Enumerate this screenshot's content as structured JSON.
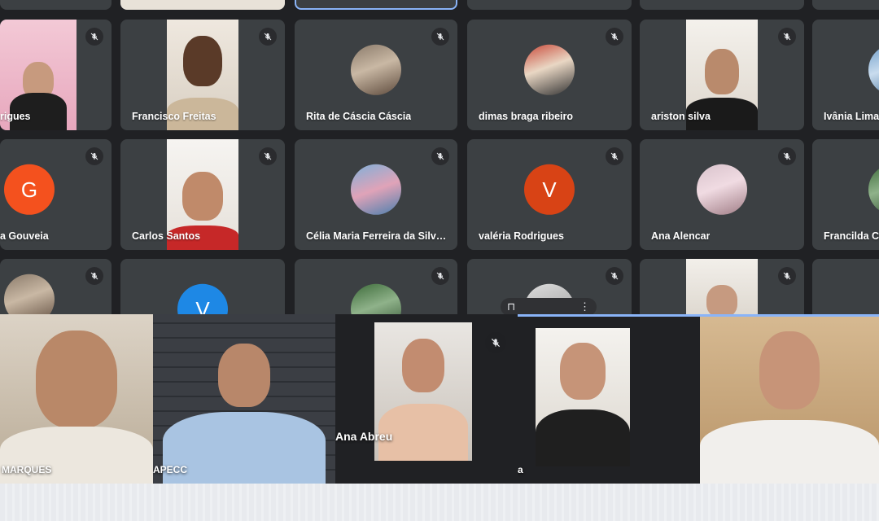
{
  "meeting": {
    "grid_tiles": [
      {
        "id": "t1",
        "name": "rigues",
        "avatar": "camera",
        "muted": true
      },
      {
        "id": "t2",
        "name": "Francisco Freitas",
        "avatar": "camera",
        "muted": true
      },
      {
        "id": "t3",
        "name": "Rita de Cáscia Cáscia",
        "avatar": "photo",
        "muted": true
      },
      {
        "id": "t4",
        "name": "dimas braga ribeiro",
        "avatar": "photo",
        "muted": true
      },
      {
        "id": "t5",
        "name": "ariston silva",
        "avatar": "camera",
        "muted": true
      },
      {
        "id": "t6",
        "name": "Ivânia Lima",
        "avatar": "photo",
        "muted": true
      },
      {
        "id": "t7",
        "name": "a Gouveia",
        "avatar": "letter",
        "letter": "G",
        "color": "#f4511e",
        "muted": true
      },
      {
        "id": "t8",
        "name": "Carlos Santos",
        "avatar": "camera",
        "muted": true
      },
      {
        "id": "t9",
        "name": "Célia Maria Ferreira da Silv…",
        "avatar": "photo",
        "muted": true
      },
      {
        "id": "t10",
        "name": "valéria Rodrigues",
        "avatar": "letter",
        "letter": "V",
        "color": "#d84315",
        "muted": true
      },
      {
        "id": "t11",
        "name": "Ana Alencar",
        "avatar": "photo",
        "muted": true
      },
      {
        "id": "t12",
        "name": "Francilda C",
        "avatar": "photo",
        "muted": true
      },
      {
        "id": "t13",
        "name": "",
        "avatar": "photo",
        "muted": true
      },
      {
        "id": "t14",
        "name": "",
        "avatar": "letter",
        "letter": "V",
        "color": "#1e88e5",
        "muted": true
      },
      {
        "id": "t15",
        "name": "",
        "avatar": "photo",
        "muted": true
      },
      {
        "id": "t16",
        "name": "",
        "avatar": "photo",
        "muted": true
      },
      {
        "id": "t17",
        "name": "",
        "avatar": "camera",
        "muted": true
      },
      {
        "id": "t18",
        "name": "",
        "avatar": "photo",
        "muted": true
      }
    ],
    "featured": [
      {
        "id": "f1",
        "name": "MARQUES"
      },
      {
        "id": "f2",
        "name": "APECC"
      },
      {
        "id": "f3",
        "name": "Ana Abreu"
      },
      {
        "id": "f4",
        "name": "a"
      },
      {
        "id": "f5",
        "name": ""
      }
    ],
    "overflow_pill": {
      "label": "⋮"
    }
  },
  "colors": {
    "background": "#202124",
    "tile": "#3c4043",
    "text": "#ffffff",
    "speaking_border": "#8ab4f8"
  }
}
